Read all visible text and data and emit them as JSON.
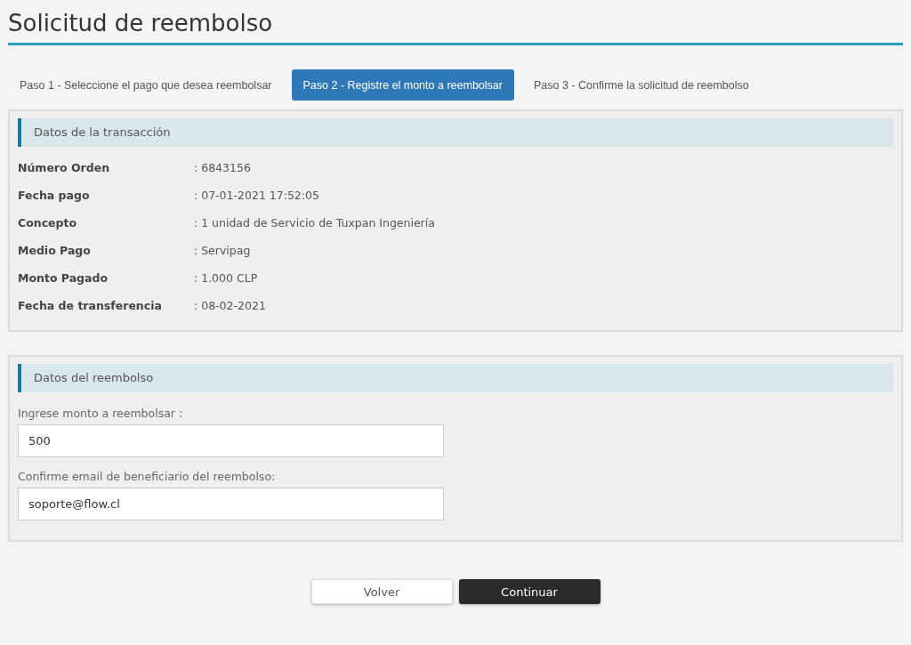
{
  "page": {
    "title": "Solicitud de reembolso"
  },
  "steps": [
    {
      "label": "Paso 1 - Seleccione el pago que desea reembolsar",
      "selected": false
    },
    {
      "label": "Paso 2 - Registre el monto a reembolsar",
      "selected": true
    },
    {
      "label": "Paso 3 - Confirme la solicitud de reembolso",
      "selected": false
    }
  ],
  "transaction": {
    "heading": "Datos de la transacción",
    "rows": [
      {
        "label": "Número Orden",
        "value": ": 6843156"
      },
      {
        "label": "Fecha pago",
        "value": ": 07-01-2021 17:52:05"
      },
      {
        "label": "Concepto",
        "value": ": 1 unidad de Servicio de Tuxpan Ingeniería"
      },
      {
        "label": "Medio Pago",
        "value": ": Servipag"
      },
      {
        "label": "Monto Pagado",
        "value": ": 1.000 CLP"
      },
      {
        "label": "Fecha de transferencia",
        "value": ": 08-02-2021"
      }
    ]
  },
  "refund": {
    "heading": "Datos del reembolso",
    "fields": [
      {
        "label": "Ingrese monto a reembolsar :",
        "value": "500"
      },
      {
        "label": "Confirme email de beneficiario del reembolso:",
        "value": "soporte@flow.cl"
      }
    ]
  },
  "buttons": [
    {
      "label": "Volver",
      "kind": "secondary"
    },
    {
      "label": "Continuar",
      "kind": "primary"
    }
  ]
}
